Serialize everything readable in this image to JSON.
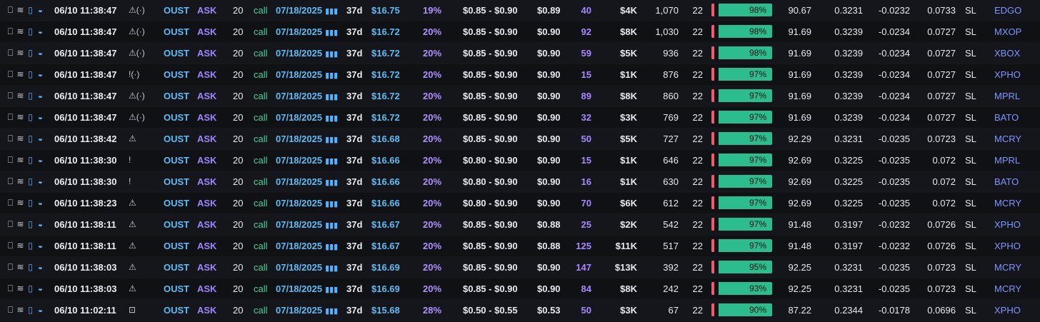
{
  "colors": {
    "background": "#111216",
    "ticker": "#62baf6",
    "side": "#9f86ff",
    "call": "#49d199",
    "bar_green": "#2cbc8d",
    "bar_red": "#f05a6d",
    "exchange": "#7e97ff"
  },
  "icons": {
    "bookmark": "bookmark-icon",
    "sweep": "sweep-waves-icon",
    "trash": "trash-icon",
    "whale": "whale-icon",
    "warning": "warning-triangle-icon",
    "broadcast": "broadcast-icon",
    "exclaim": "exclamation-icon",
    "lockbox": "briefcase-icon",
    "chart": "bar-chart-icon"
  },
  "rows": [
    {
      "time": "06/10 11:38:47",
      "alert": "⚠(·)",
      "ticker": "OUST",
      "side": "ASK",
      "qty": "20",
      "type": "call",
      "expiry": "07/18/2025",
      "dte": "37d",
      "price": "$16.75",
      "pct": "19%",
      "bidask": "$0.85 - $0.90",
      "fill": "$0.89",
      "size": "40",
      "premium": "$4K",
      "volume": "1,070",
      "oi": "22",
      "bar_label": "98%",
      "bar_pct": 98,
      "iv": "90.67",
      "delta": "0.3231",
      "theta": "-0.0232",
      "gamma": "0.0733",
      "sl": "SL",
      "exch": "EDGO"
    },
    {
      "time": "06/10 11:38:47",
      "alert": "⚠(·)",
      "ticker": "OUST",
      "side": "ASK",
      "qty": "20",
      "type": "call",
      "expiry": "07/18/2025",
      "dte": "37d",
      "price": "$16.72",
      "pct": "20%",
      "bidask": "$0.85 - $0.90",
      "fill": "$0.90",
      "size": "92",
      "premium": "$8K",
      "volume": "1,030",
      "oi": "22",
      "bar_label": "98%",
      "bar_pct": 98,
      "iv": "91.69",
      "delta": "0.3239",
      "theta": "-0.0234",
      "gamma": "0.0727",
      "sl": "SL",
      "exch": "MXOP"
    },
    {
      "time": "06/10 11:38:47",
      "alert": "⚠(·)",
      "ticker": "OUST",
      "side": "ASK",
      "qty": "20",
      "type": "call",
      "expiry": "07/18/2025",
      "dte": "37d",
      "price": "$16.72",
      "pct": "20%",
      "bidask": "$0.85 - $0.90",
      "fill": "$0.90",
      "size": "59",
      "premium": "$5K",
      "volume": "936",
      "oi": "22",
      "bar_label": "98%",
      "bar_pct": 98,
      "iv": "91.69",
      "delta": "0.3239",
      "theta": "-0.0234",
      "gamma": "0.0727",
      "sl": "SL",
      "exch": "XBOX"
    },
    {
      "time": "06/10 11:38:47",
      "alert": "!(·)",
      "ticker": "OUST",
      "side": "ASK",
      "qty": "20",
      "type": "call",
      "expiry": "07/18/2025",
      "dte": "37d",
      "price": "$16.72",
      "pct": "20%",
      "bidask": "$0.85 - $0.90",
      "fill": "$0.90",
      "size": "15",
      "premium": "$1K",
      "volume": "876",
      "oi": "22",
      "bar_label": "97%",
      "bar_pct": 97,
      "iv": "91.69",
      "delta": "0.3239",
      "theta": "-0.0234",
      "gamma": "0.0727",
      "sl": "SL",
      "exch": "XPHO"
    },
    {
      "time": "06/10 11:38:47",
      "alert": "⚠(·)",
      "ticker": "OUST",
      "side": "ASK",
      "qty": "20",
      "type": "call",
      "expiry": "07/18/2025",
      "dte": "37d",
      "price": "$16.72",
      "pct": "20%",
      "bidask": "$0.85 - $0.90",
      "fill": "$0.90",
      "size": "89",
      "premium": "$8K",
      "volume": "860",
      "oi": "22",
      "bar_label": "97%",
      "bar_pct": 97,
      "iv": "91.69",
      "delta": "0.3239",
      "theta": "-0.0234",
      "gamma": "0.0727",
      "sl": "SL",
      "exch": "MPRL"
    },
    {
      "time": "06/10 11:38:47",
      "alert": "⚠(·)",
      "ticker": "OUST",
      "side": "ASK",
      "qty": "20",
      "type": "call",
      "expiry": "07/18/2025",
      "dte": "37d",
      "price": "$16.72",
      "pct": "20%",
      "bidask": "$0.85 - $0.90",
      "fill": "$0.90",
      "size": "32",
      "premium": "$3K",
      "volume": "769",
      "oi": "22",
      "bar_label": "97%",
      "bar_pct": 97,
      "iv": "91.69",
      "delta": "0.3239",
      "theta": "-0.0234",
      "gamma": "0.0727",
      "sl": "SL",
      "exch": "BATO"
    },
    {
      "time": "06/10 11:38:42",
      "alert": "⚠",
      "ticker": "OUST",
      "side": "ASK",
      "qty": "20",
      "type": "call",
      "expiry": "07/18/2025",
      "dte": "37d",
      "price": "$16.68",
      "pct": "20%",
      "bidask": "$0.85 - $0.90",
      "fill": "$0.90",
      "size": "50",
      "premium": "$5K",
      "volume": "727",
      "oi": "22",
      "bar_label": "97%",
      "bar_pct": 97,
      "iv": "92.29",
      "delta": "0.3231",
      "theta": "-0.0235",
      "gamma": "0.0723",
      "sl": "SL",
      "exch": "MCRY"
    },
    {
      "time": "06/10 11:38:30",
      "alert": "!",
      "ticker": "OUST",
      "side": "ASK",
      "qty": "20",
      "type": "call",
      "expiry": "07/18/2025",
      "dte": "37d",
      "price": "$16.66",
      "pct": "20%",
      "bidask": "$0.80 - $0.90",
      "fill": "$0.90",
      "size": "15",
      "premium": "$1K",
      "volume": "646",
      "oi": "22",
      "bar_label": "97%",
      "bar_pct": 97,
      "iv": "92.69",
      "delta": "0.3225",
      "theta": "-0.0235",
      "gamma": "0.072",
      "sl": "SL",
      "exch": "MPRL"
    },
    {
      "time": "06/10 11:38:30",
      "alert": "!",
      "ticker": "OUST",
      "side": "ASK",
      "qty": "20",
      "type": "call",
      "expiry": "07/18/2025",
      "dte": "37d",
      "price": "$16.66",
      "pct": "20%",
      "bidask": "$0.80 - $0.90",
      "fill": "$0.90",
      "size": "16",
      "premium": "$1K",
      "volume": "630",
      "oi": "22",
      "bar_label": "97%",
      "bar_pct": 97,
      "iv": "92.69",
      "delta": "0.3225",
      "theta": "-0.0235",
      "gamma": "0.072",
      "sl": "SL",
      "exch": "BATO"
    },
    {
      "time": "06/10 11:38:23",
      "alert": "⚠",
      "ticker": "OUST",
      "side": "ASK",
      "qty": "20",
      "type": "call",
      "expiry": "07/18/2025",
      "dte": "37d",
      "price": "$16.66",
      "pct": "20%",
      "bidask": "$0.80 - $0.90",
      "fill": "$0.90",
      "size": "70",
      "premium": "$6K",
      "volume": "612",
      "oi": "22",
      "bar_label": "97%",
      "bar_pct": 97,
      "iv": "92.69",
      "delta": "0.3225",
      "theta": "-0.0235",
      "gamma": "0.072",
      "sl": "SL",
      "exch": "MCRY"
    },
    {
      "time": "06/10 11:38:11",
      "alert": "⚠",
      "ticker": "OUST",
      "side": "ASK",
      "qty": "20",
      "type": "call",
      "expiry": "07/18/2025",
      "dte": "37d",
      "price": "$16.67",
      "pct": "20%",
      "bidask": "$0.85 - $0.90",
      "fill": "$0.88",
      "size": "25",
      "premium": "$2K",
      "volume": "542",
      "oi": "22",
      "bar_label": "97%",
      "bar_pct": 97,
      "iv": "91.48",
      "delta": "0.3197",
      "theta": "-0.0232",
      "gamma": "0.0726",
      "sl": "SL",
      "exch": "XPHO"
    },
    {
      "time": "06/10 11:38:11",
      "alert": "⚠",
      "ticker": "OUST",
      "side": "ASK",
      "qty": "20",
      "type": "call",
      "expiry": "07/18/2025",
      "dte": "37d",
      "price": "$16.67",
      "pct": "20%",
      "bidask": "$0.85 - $0.90",
      "fill": "$0.88",
      "size": "125",
      "premium": "$11K",
      "volume": "517",
      "oi": "22",
      "bar_label": "97%",
      "bar_pct": 97,
      "iv": "91.48",
      "delta": "0.3197",
      "theta": "-0.0232",
      "gamma": "0.0726",
      "sl": "SL",
      "exch": "XPHO"
    },
    {
      "time": "06/10 11:38:03",
      "alert": "⚠",
      "ticker": "OUST",
      "side": "ASK",
      "qty": "20",
      "type": "call",
      "expiry": "07/18/2025",
      "dte": "37d",
      "price": "$16.69",
      "pct": "20%",
      "bidask": "$0.85 - $0.90",
      "fill": "$0.90",
      "size": "147",
      "premium": "$13K",
      "volume": "392",
      "oi": "22",
      "bar_label": "95%",
      "bar_pct": 95,
      "iv": "92.25",
      "delta": "0.3231",
      "theta": "-0.0235",
      "gamma": "0.0723",
      "sl": "SL",
      "exch": "MCRY"
    },
    {
      "time": "06/10 11:38:03",
      "alert": "⚠",
      "ticker": "OUST",
      "side": "ASK",
      "qty": "20",
      "type": "call",
      "expiry": "07/18/2025",
      "dte": "37d",
      "price": "$16.69",
      "pct": "20%",
      "bidask": "$0.85 - $0.90",
      "fill": "$0.90",
      "size": "84",
      "premium": "$8K",
      "volume": "242",
      "oi": "22",
      "bar_label": "93%",
      "bar_pct": 93,
      "iv": "92.25",
      "delta": "0.3231",
      "theta": "-0.0235",
      "gamma": "0.0723",
      "sl": "SL",
      "exch": "MCRY"
    },
    {
      "time": "06/10 11:02:11",
      "alert": "⊡",
      "ticker": "OUST",
      "side": "ASK",
      "qty": "20",
      "type": "call",
      "expiry": "07/18/2025",
      "dte": "37d",
      "price": "$15.68",
      "pct": "28%",
      "bidask": "$0.50 - $0.55",
      "fill": "$0.53",
      "size": "50",
      "premium": "$3K",
      "volume": "67",
      "oi": "22",
      "bar_label": "90%",
      "bar_pct": 90,
      "iv": "87.22",
      "delta": "0.2344",
      "theta": "-0.0178",
      "gamma": "0.0696",
      "sl": "SL",
      "exch": "XPHO"
    }
  ]
}
